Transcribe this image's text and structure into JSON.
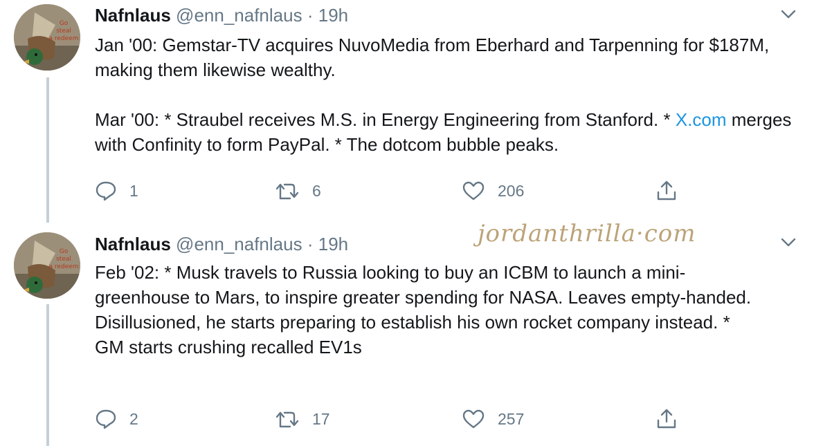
{
  "tweets": [
    {
      "author_name": "Nafnlaus",
      "handle": "@enn_nafnlaus",
      "separator": "·",
      "time": "19h",
      "body": {
        "p1": "Jan '00: Gemstar-TV acquires NuvoMedia from Eberhard and Tarpenning for $187M, making them likewise wealthy.",
        "p2_start": "Mar '00: * Straubel receives M.S. in Energy Engineering from Stanford. *",
        "p2_link": "X.com",
        "p2_end": " merges with Confinity to form PayPal. * The dotcom bubble peaks."
      },
      "actions": {
        "replies": "1",
        "retweets": "6",
        "likes": "206"
      },
      "avatar_text": "Go steal a redeem"
    },
    {
      "author_name": "Nafnlaus",
      "handle": "@enn_nafnlaus",
      "separator": "·",
      "time": "19h",
      "body": {
        "p1": "Feb '02: * Musk travels to Russia looking to buy an ICBM to launch a mini-greenhouse to Mars, to inspire greater spending for NASA. Leaves empty-handed.",
        "p2": "Disillusioned, he starts preparing to establish his own rocket company instead. * GM starts crushing recalled EV1s"
      },
      "actions": {
        "replies": "2",
        "retweets": "17",
        "likes": "257"
      },
      "avatar_text": "Go steal a redeem"
    }
  ],
  "watermark": "jordanthrilla·com",
  "icons": {
    "reply": "reply-icon",
    "retweet": "retweet-icon",
    "like": "heart-icon",
    "share": "share-icon",
    "more": "chevron-down-icon"
  },
  "colors": {
    "text": "#14171a",
    "secondary": "#657786",
    "link": "#1b95e0",
    "thread_line": "#c4cfd6"
  }
}
